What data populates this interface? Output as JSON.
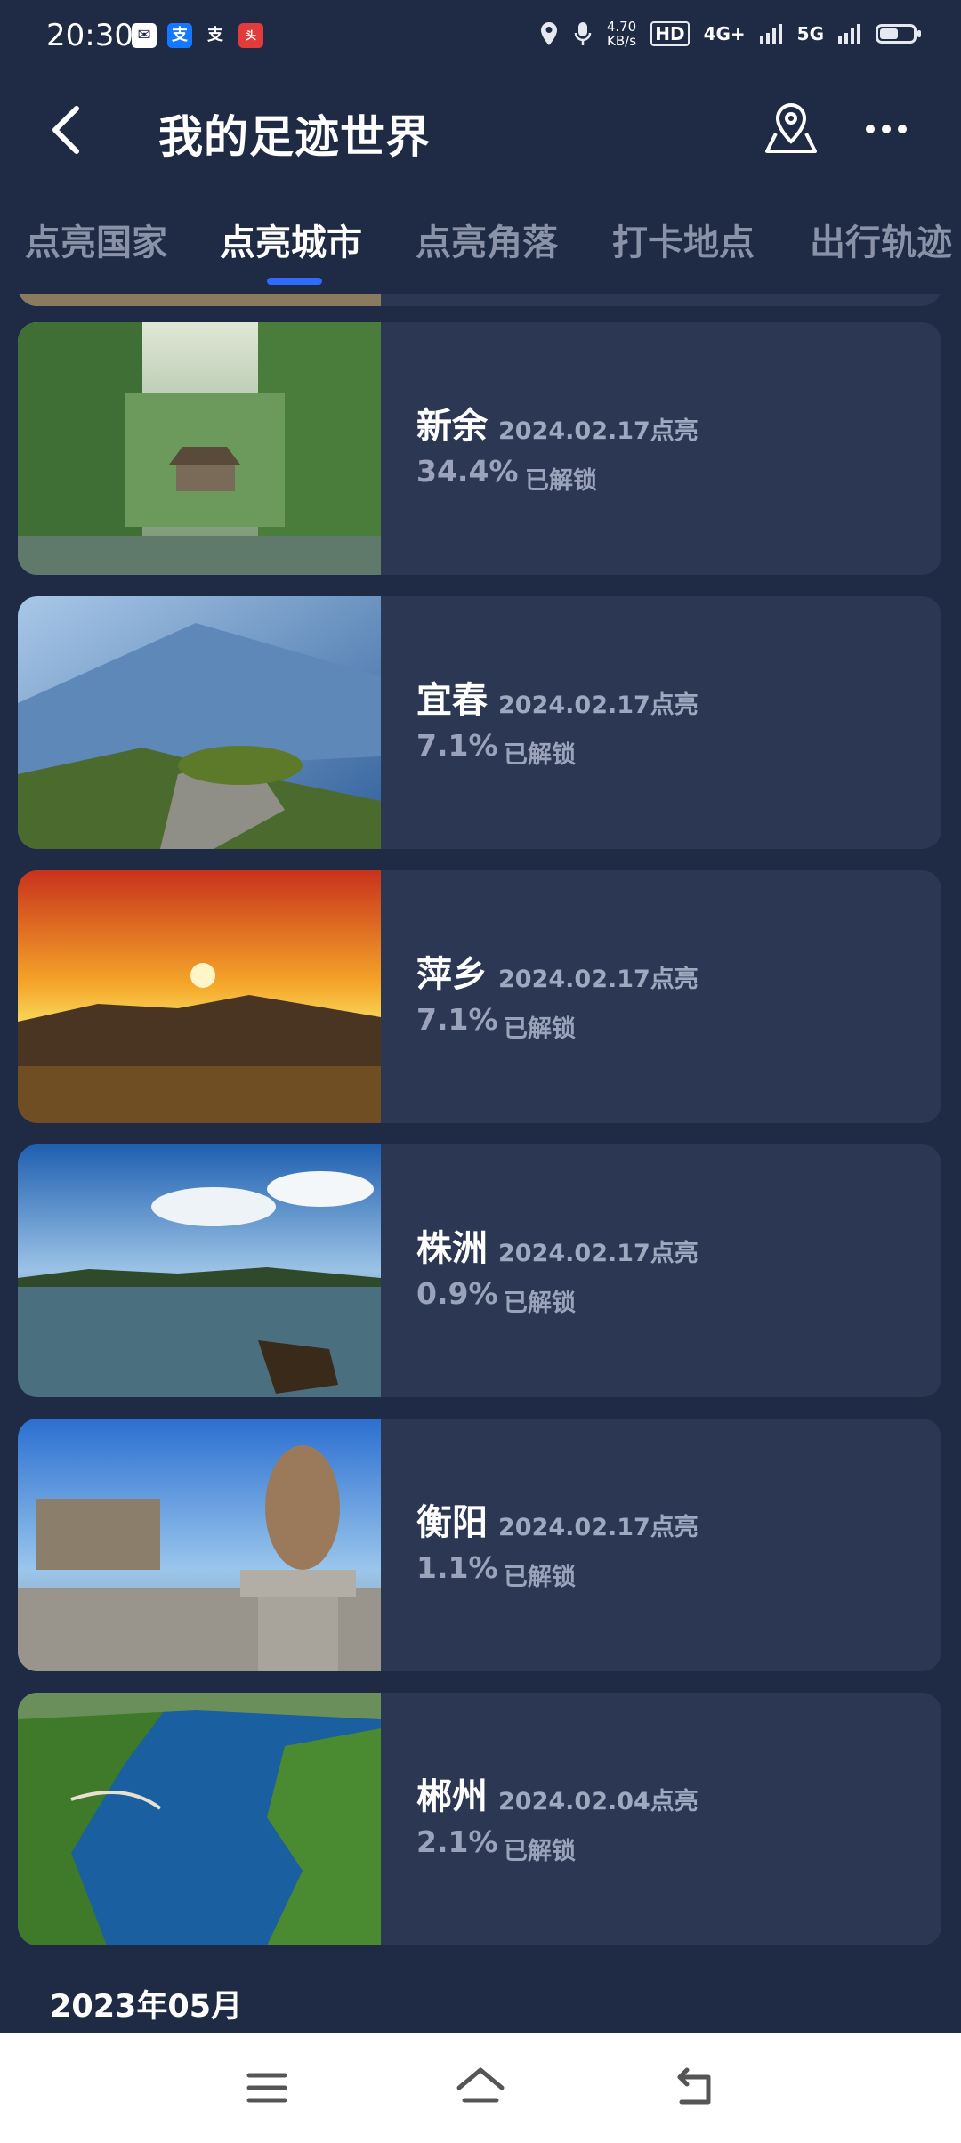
{
  "status_bar": {
    "time": "20:30",
    "speed_value": "4.70",
    "speed_unit": "KB/s",
    "hd_label": "HD",
    "net1": "4G+",
    "net2": "5G",
    "battery_level": 0.55,
    "app_icons": [
      "mail-icon",
      "alipay-icon",
      "alipay-outline-icon",
      "news-app-icon"
    ]
  },
  "header": {
    "title": "我的足迹世界",
    "icons": [
      "back-arrow-icon",
      "map-pin-icon",
      "more-dots-icon"
    ]
  },
  "tabs": [
    {
      "label": "点亮国家"
    },
    {
      "label": "点亮城市"
    },
    {
      "label": "点亮角落"
    },
    {
      "label": "打卡地点"
    },
    {
      "label": "出行轨迹"
    }
  ],
  "active_tab": "点亮城市",
  "cities": [
    {
      "name": "新余",
      "date": "2024.02.17点亮",
      "percent": "34.4%",
      "unlock_text": "已解锁"
    },
    {
      "name": "宜春",
      "date": "2024.02.17点亮",
      "percent": "7.1%",
      "unlock_text": "已解锁"
    },
    {
      "name": "萍乡",
      "date": "2024.02.17点亮",
      "percent": "7.1%",
      "unlock_text": "已解锁"
    },
    {
      "name": "株洲",
      "date": "2024.02.17点亮",
      "percent": "0.9%",
      "unlock_text": "已解锁"
    },
    {
      "name": "衡阳",
      "date": "2024.02.17点亮",
      "percent": "1.1%",
      "unlock_text": "已解锁"
    },
    {
      "name": "郴州",
      "date": "2024.02.04点亮",
      "percent": "2.1%",
      "unlock_text": "已解锁"
    }
  ],
  "section_header": "2023年05月",
  "nav_icons": [
    "menu-icon",
    "home-icon",
    "back-icon"
  ],
  "colors": {
    "background": "#1f2a44",
    "card": "#2b3753",
    "accent": "#2f6bff",
    "muted_text": "#9aa3ba"
  }
}
